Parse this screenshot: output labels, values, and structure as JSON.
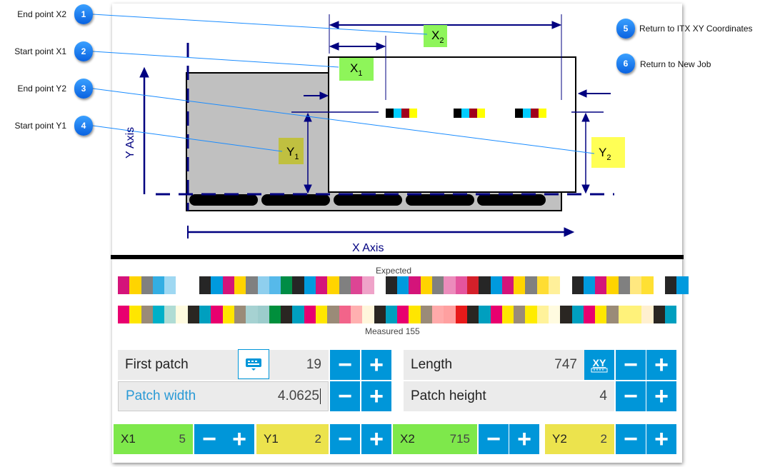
{
  "callouts": [
    {
      "n": "1",
      "label": "End point X2"
    },
    {
      "n": "2",
      "label": "Start point X1"
    },
    {
      "n": "3",
      "label": "End point Y2"
    },
    {
      "n": "4",
      "label": "Start point Y1"
    },
    {
      "n": "5",
      "label": "Return to ITX XY Coordinates"
    },
    {
      "n": "6",
      "label": "Return to New Job"
    }
  ],
  "diagram": {
    "x1": "X",
    "x1_sub": "1",
    "x2": "X",
    "x2_sub": "2",
    "y1": "Y",
    "y1_sub": "1",
    "y2": "Y",
    "y2_sub": "2",
    "x_axis": "X Axis",
    "y_axis": "Y Axis"
  },
  "patches": {
    "expected_label": "Expected",
    "measured_label": "Measured 155",
    "expected": [
      "#d4147a",
      "#ffd400",
      "#808080",
      "#33aee3",
      "#9fd8f2",
      null,
      null,
      "#262626",
      "#009ade",
      "#d4147a",
      "#ffd400",
      "#808080",
      "#8fcfee",
      "#56b9ea",
      "#008c45",
      "#262626",
      "#009ade",
      "#d4147a",
      "#ffd400",
      "#808080",
      "#dd4594",
      "#efa3c9",
      null,
      "#262626",
      "#009ade",
      "#d4147a",
      "#ffd400",
      "#808080",
      "#ec8cbc",
      "#e4559e",
      "#d4202a",
      "#262626",
      "#009ade",
      "#d4147a",
      "#ffd400",
      "#808080",
      "#ffdd33",
      "#fff09a",
      null,
      "#262626",
      "#009ade",
      "#d4147a",
      "#ffd400",
      "#808080",
      "#ffe880",
      "#ffe033",
      null,
      "#262626",
      "#009ade"
    ],
    "measured": [
      "#e8006f",
      "#ffe600",
      "#9a8b78",
      "#00b0c8",
      "#b0dcd4",
      "#fffbe0",
      "#2a2622",
      "#009fbf",
      "#e8006f",
      "#ffe600",
      "#9a8b78",
      "#a6d2d2",
      "#9ccccc",
      "#008f3c",
      "#2a2622",
      "#009fbf",
      "#e8006f",
      "#ffe600",
      "#9a8b78",
      "#f2648a",
      "#ffb0b0",
      "#fff6dc",
      "#2a2622",
      "#009fbf",
      "#e8006f",
      "#ffe600",
      "#9a8b78",
      "#ffaaaa",
      "#ffa0a0",
      "#e81a1a",
      "#2a2622",
      "#009fbf",
      "#e8006f",
      "#ffe600",
      "#9a8b78",
      "#ffec00",
      "#fff29a",
      "#fffbe0",
      "#2a2622",
      "#009fbf",
      "#e8006f",
      "#ffe600",
      "#9a8b78",
      "#fff27a",
      "#fff27a",
      "#fff0d0",
      "#2a2622",
      "#009fbf"
    ]
  },
  "controls": {
    "first_patch": {
      "label": "First patch",
      "value": "19"
    },
    "length": {
      "label": "Length",
      "value": "747"
    },
    "xy_button": "XY",
    "patch_width": {
      "label": "Patch width",
      "value": "4.0625"
    },
    "patch_height": {
      "label": "Patch height",
      "value": "4"
    },
    "x1": {
      "label": "X1",
      "value": "5"
    },
    "y1": {
      "label": "Y1",
      "value": "2"
    },
    "x2": {
      "label": "X2",
      "value": "715"
    },
    "y2": {
      "label": "Y2",
      "value": "2"
    },
    "minus": "−",
    "plus": "+"
  },
  "colors": {
    "accent": "#0096d9",
    "green": "#7ee84b",
    "yellow": "#ece34d",
    "callout": "#0a62e0"
  }
}
